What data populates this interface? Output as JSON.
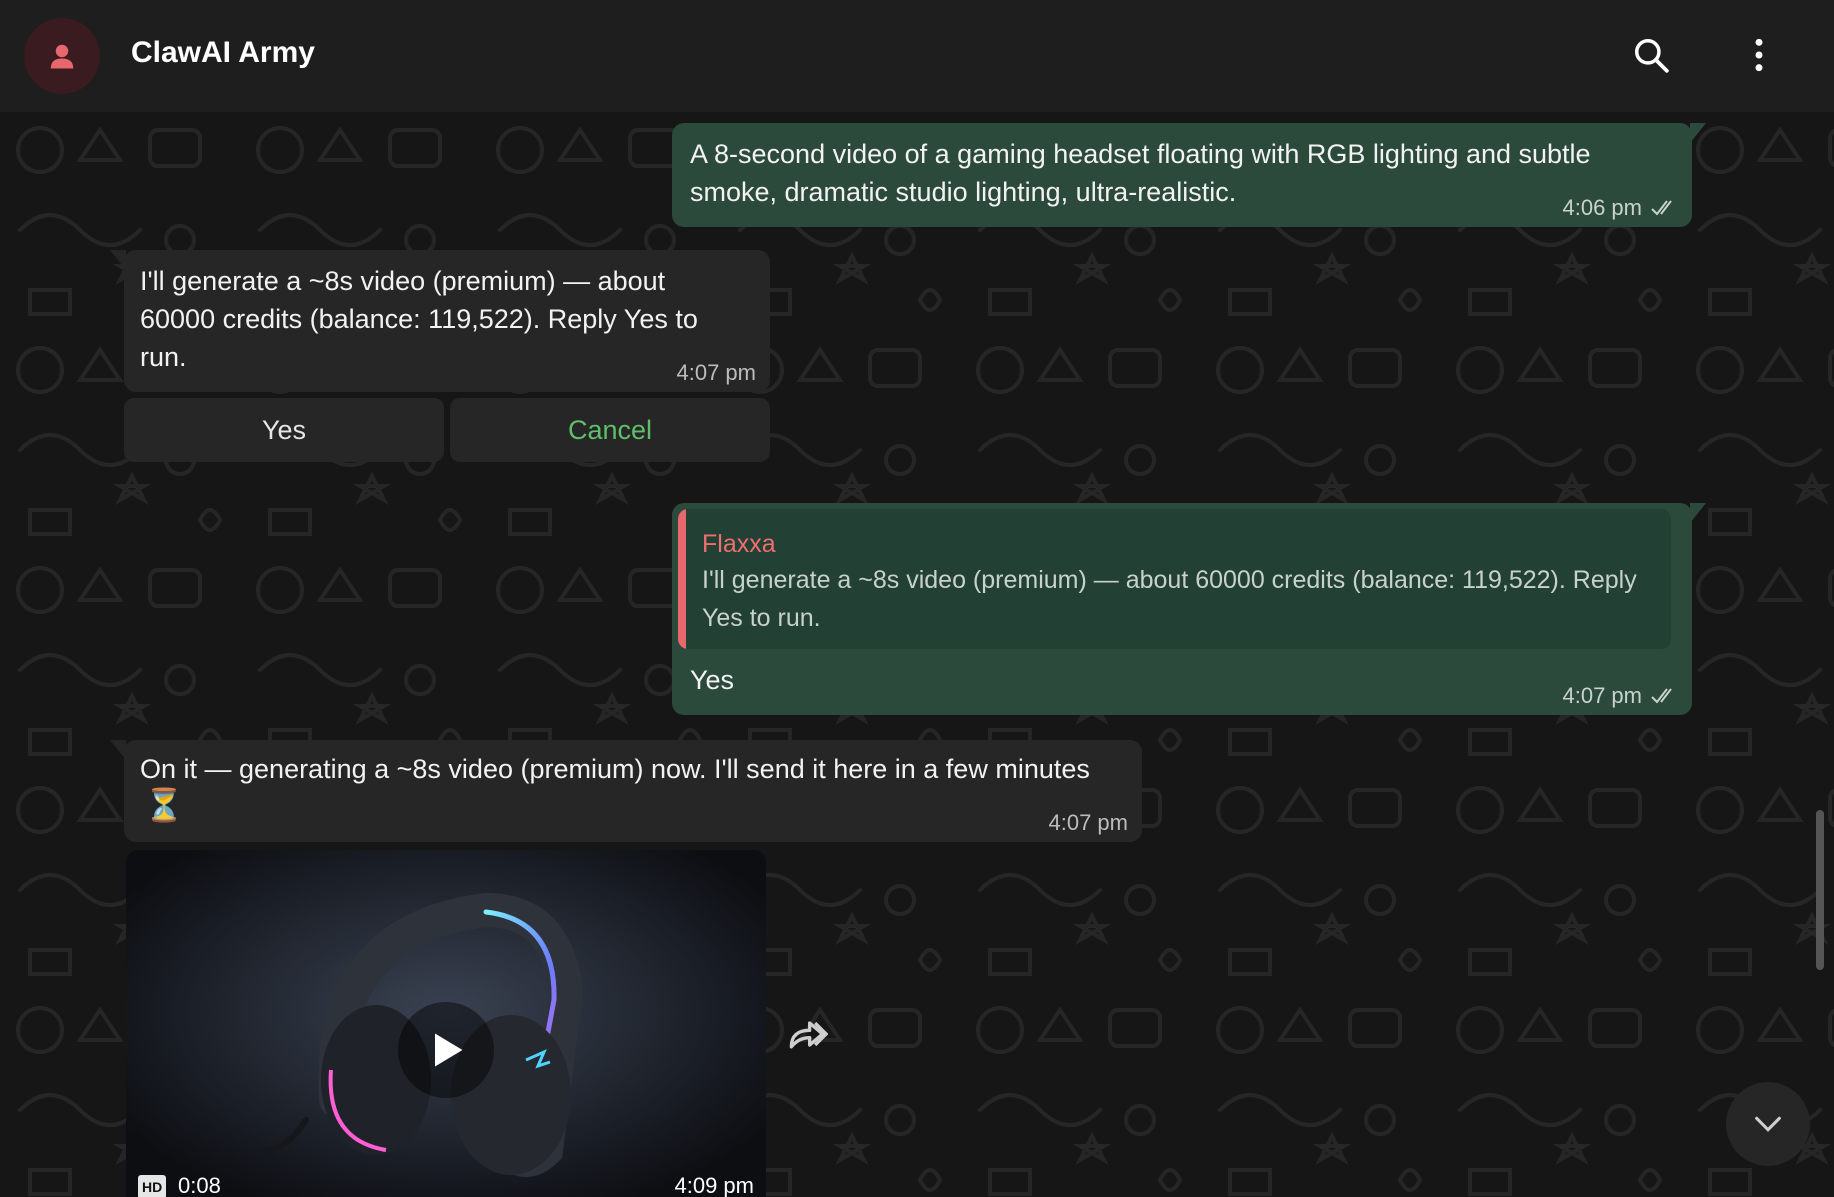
{
  "header": {
    "title": "ClawAI Army",
    "avatar_icon": "user-icon",
    "search_icon": "search-icon",
    "menu_icon": "more-vertical-icon"
  },
  "messages": [
    {
      "direction": "out",
      "text": "A 8-second video of a gaming headset floating with RGB lighting and subtle smoke, dramatic studio lighting, ultra-realistic.",
      "time": "4:06 pm",
      "status_icon": "double-check-icon"
    },
    {
      "direction": "in",
      "text": "I'll generate a ~8s video (premium) — about 60000 credits (balance: 119,522). Reply Yes to run.",
      "time": "4:07 pm",
      "buttons": [
        "Yes",
        "Cancel"
      ]
    },
    {
      "direction": "out",
      "reply_to": {
        "name": "Flaxxa",
        "text": "I'll generate a ~8s video (premium) — about 60000 credits (balance: 119,522). Reply Yes to run."
      },
      "text": "Yes",
      "time": "4:07 pm",
      "status_icon": "double-check-icon"
    },
    {
      "direction": "in",
      "text": "On it — generating a ~8s video (premium) now. I'll send it here in a few minutes",
      "emoji": "⏳",
      "time": "4:07 pm"
    },
    {
      "direction": "in",
      "type": "video",
      "badge": "HD",
      "duration": "0:08",
      "time": "4:09 pm"
    }
  ],
  "colors": {
    "outgoing_bubble": "#2b4a3b",
    "incoming_bubble": "#262626",
    "background": "#161616",
    "accent_red": "#ef6f6f",
    "cancel_green": "#5fbf6a"
  }
}
